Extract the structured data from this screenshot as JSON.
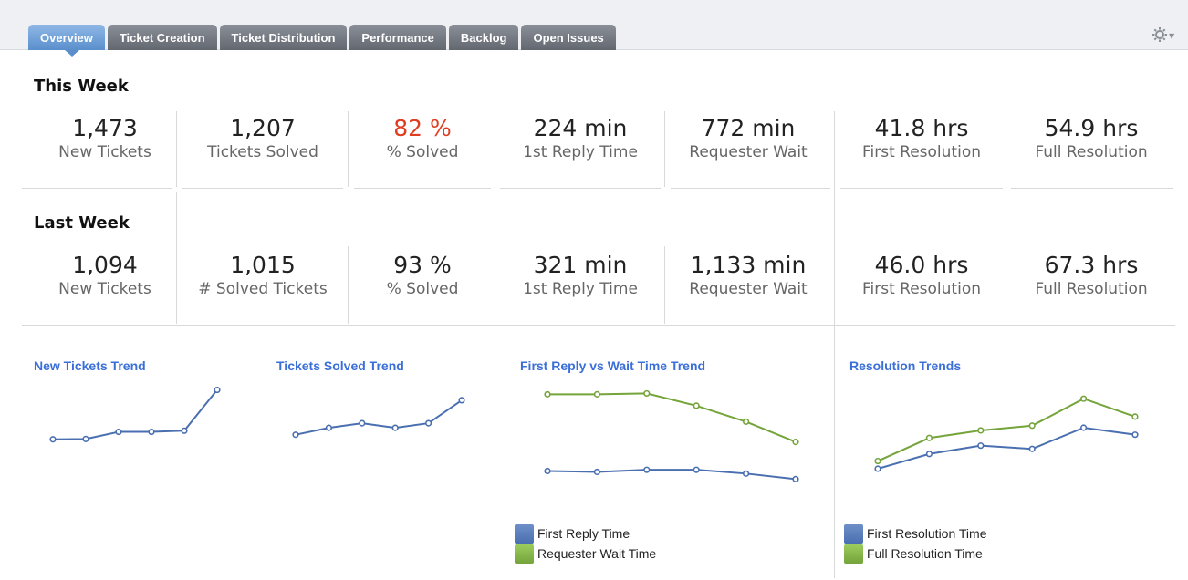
{
  "tabs": [
    {
      "label": "Overview",
      "active": true
    },
    {
      "label": "Ticket Creation",
      "active": false
    },
    {
      "label": "Ticket Distribution",
      "active": false
    },
    {
      "label": "Performance",
      "active": false
    },
    {
      "label": "Backlog",
      "active": false
    },
    {
      "label": "Open Issues",
      "active": false
    }
  ],
  "settings_icon": "gear-icon",
  "this_week": {
    "title": "This Week",
    "stats": [
      {
        "value": "1,473",
        "label": "New Tickets"
      },
      {
        "value": "1,207",
        "label": "Tickets Solved"
      },
      {
        "value": "82 %",
        "label": "% Solved",
        "color": "#e03c1f"
      },
      {
        "value": "224 min",
        "label": "1st Reply Time"
      },
      {
        "value": "772 min",
        "label": "Requester Wait"
      },
      {
        "value": "41.8 hrs",
        "label": "First Resolution"
      },
      {
        "value": "54.9 hrs",
        "label": "Full Resolution"
      }
    ]
  },
  "last_week": {
    "title": "Last Week",
    "stats": [
      {
        "value": "1,094",
        "label": "New Tickets"
      },
      {
        "value": "1,015",
        "label": "# Solved Tickets"
      },
      {
        "value": "93 %",
        "label": "% Solved"
      },
      {
        "value": "321 min",
        "label": "1st Reply Time"
      },
      {
        "value": "1,133 min",
        "label": "Requester Wait"
      },
      {
        "value": "46.0 hrs",
        "label": "First Resolution"
      },
      {
        "value": "67.3 hrs",
        "label": "Full Resolution"
      }
    ]
  },
  "colors": {
    "blue_series": "#4a6fb0",
    "green_series": "#74a43a",
    "accent": "#e03c1f"
  },
  "chart_data": [
    {
      "type": "line",
      "title": "New Tickets Trend",
      "x": [
        1,
        2,
        3,
        4,
        5,
        6
      ],
      "series": [
        {
          "values": [
            1.0,
            1.3,
            7.5,
            7.5,
            8.5,
            44.0
          ]
        }
      ],
      "ylim": [
        0,
        50
      ]
    },
    {
      "type": "line",
      "title": "Tickets Solved Trend",
      "x": [
        1,
        2,
        3,
        4,
        5,
        6
      ],
      "series": [
        {
          "values": [
            5.0,
            11.0,
            15.0,
            11.0,
            15.0,
            35.0
          ]
        }
      ],
      "ylim": [
        0,
        50
      ]
    },
    {
      "type": "line",
      "title": "First Reply vs Wait Time Trend",
      "x": [
        1,
        2,
        3,
        4,
        5,
        6
      ],
      "series": [
        {
          "name": "First Reply Time",
          "values": [
            18.8,
            17.9,
            20.1,
            20.1,
            16.1,
            10.3
          ]
        },
        {
          "name": "Requester Wait Time",
          "values": [
            100.0,
            100.0,
            100.9,
            87.9,
            71.0,
            49.6
          ]
        }
      ],
      "ylim": [
        0,
        110
      ]
    },
    {
      "type": "line",
      "title": "Resolution Trends",
      "x": [
        1,
        2,
        3,
        4,
        5,
        6
      ],
      "series": [
        {
          "name": "First Resolution Time",
          "values": [
            5.2,
            22.1,
            31.6,
            27.9,
            52.1,
            44.1
          ]
        },
        {
          "name": "Full Resolution Time",
          "values": [
            14.0,
            40.4,
            49.0,
            54.4,
            85.2,
            64.7
          ]
        }
      ],
      "ylim": [
        0,
        100
      ]
    }
  ]
}
